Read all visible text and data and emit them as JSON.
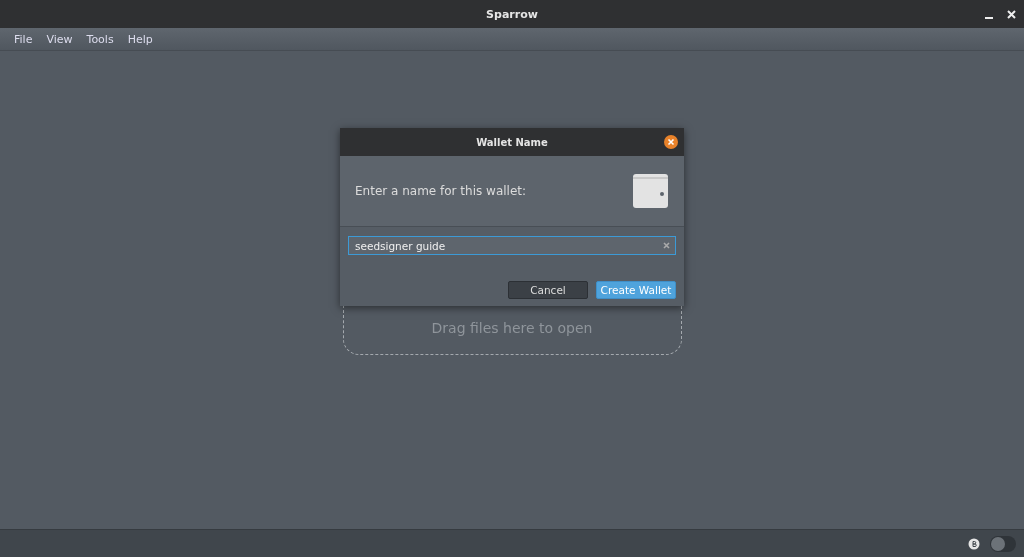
{
  "window": {
    "title": "Sparrow"
  },
  "menu": [
    "File",
    "View",
    "Tools",
    "Help"
  ],
  "drop_zone": {
    "text": "Drag files here to open"
  },
  "dialog": {
    "title": "Wallet Name",
    "prompt": "Enter a name for this wallet:",
    "field": {
      "value": "seedsigner guide"
    },
    "buttons": [
      {
        "label": "Cancel",
        "kind": "secondary"
      },
      {
        "label": "Create Wallet",
        "kind": "primary"
      }
    ]
  },
  "status_bar": {
    "toggle": {
      "on": false
    }
  }
}
